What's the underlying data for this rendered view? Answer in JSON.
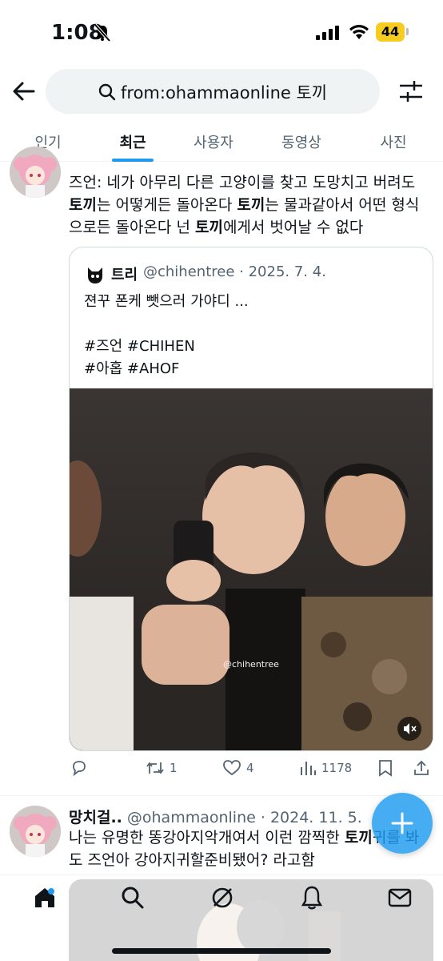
{
  "status_bar": {
    "time": "1:08",
    "battery": "44",
    "icons": [
      "bell-slash-icon",
      "signal-icon",
      "wifi-icon",
      "battery-icon"
    ]
  },
  "header": {
    "search_query": "from:ohammaonline 토끼"
  },
  "tabs": [
    {
      "label": "인기"
    },
    {
      "label": "최근"
    },
    {
      "label": "사용자"
    },
    {
      "label": "동영상"
    },
    {
      "label": "사진"
    }
  ],
  "tweet1": {
    "text": {
      "p1": "즈언: 네가 아무리 다른 고양이를 찾고 도망치고 버려도 ",
      "b1": "토끼",
      "p2": "는 어떻게든 돌아온다 ",
      "b2": "토끼",
      "p3": "는 물과같아서 어떤 형식으로든 돌아온다 넌 ",
      "b3": "토끼",
      "p4": "에게서 벗어날 수 없다"
    },
    "quote": {
      "name": "트리",
      "handle": "@chihentree",
      "date": "2025. 7. 4.",
      "line1": "젼꾸 폰케 뺏으러 가야디 ...",
      "line2": "#즈언 #CHIHEN",
      "line3": "#아홉 #AHOF",
      "watermark": "@chihentree"
    },
    "actions": {
      "reply": "",
      "retweets": "1",
      "likes": "4",
      "views": "1178"
    }
  },
  "tweet2": {
    "name": "망치걸..",
    "handle": "@ohammaonline",
    "date": "2024. 11. 5.",
    "text": {
      "p1": "나는 유명한 똥강아지악개여서 이런 깜찍한 ",
      "b1": "토끼",
      "p2": "귀를 봐도 즈언아 강아지귀할준비됐어? 라고함"
    }
  },
  "colors": {
    "accent": "#1d9bf0",
    "secondary_text": "#536471",
    "battery": "#f5cc1f"
  }
}
